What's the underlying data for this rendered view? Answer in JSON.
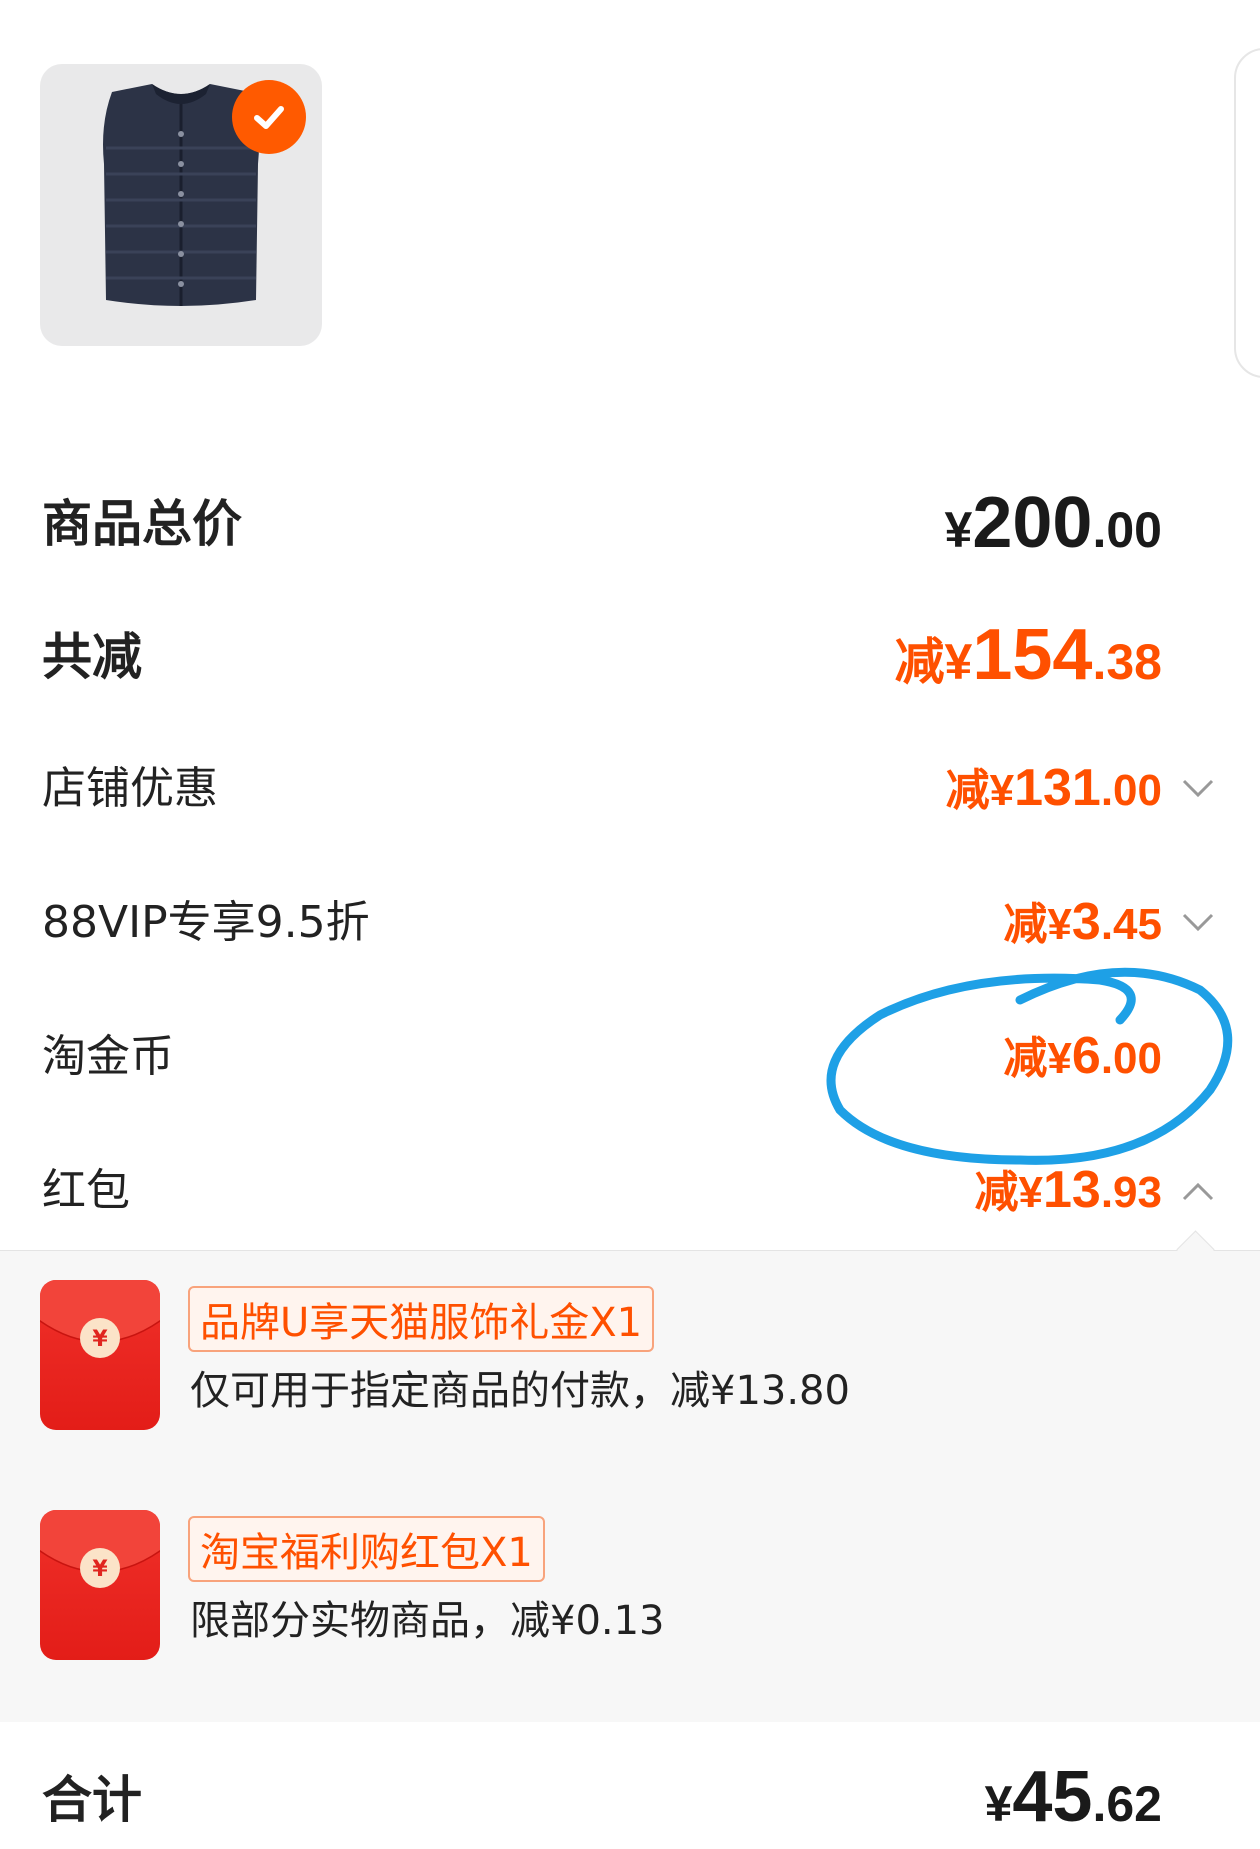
{
  "product": {
    "image": "vest-icon",
    "selected_icon": "checkmark-icon"
  },
  "summary": {
    "total": {
      "label": "商品总价",
      "currency": "¥",
      "int": "200",
      "dec": ".00"
    },
    "discount_total": {
      "label": "共减",
      "prefix": "减¥",
      "int": "154",
      "dec": ".38"
    },
    "store": {
      "label": "店铺优惠",
      "prefix": "减¥",
      "int": "131",
      "dec": ".00"
    },
    "vip": {
      "label": "88VIP专享9.5折",
      "prefix": "减¥",
      "int": "3",
      "dec": ".45"
    },
    "coins": {
      "label": "淘金币",
      "prefix": "减¥",
      "int": "6",
      "dec": ".00"
    },
    "redpacket": {
      "label": "红包",
      "prefix": "减¥",
      "int": "13",
      "dec": ".93"
    }
  },
  "redpackets": [
    {
      "tag": "品牌U享天猫服饰礼金X1",
      "desc": "仅可用于指定商品的付款，减¥13.80"
    },
    {
      "tag": "淘宝福利购红包X1",
      "desc": "限部分实物商品，减¥0.13"
    }
  ],
  "footer": {
    "label": "合计",
    "currency": "¥",
    "int": "45",
    "dec": ".62"
  },
  "colors": {
    "accent": "#ff5000",
    "annotation": "#1ea0e6"
  }
}
